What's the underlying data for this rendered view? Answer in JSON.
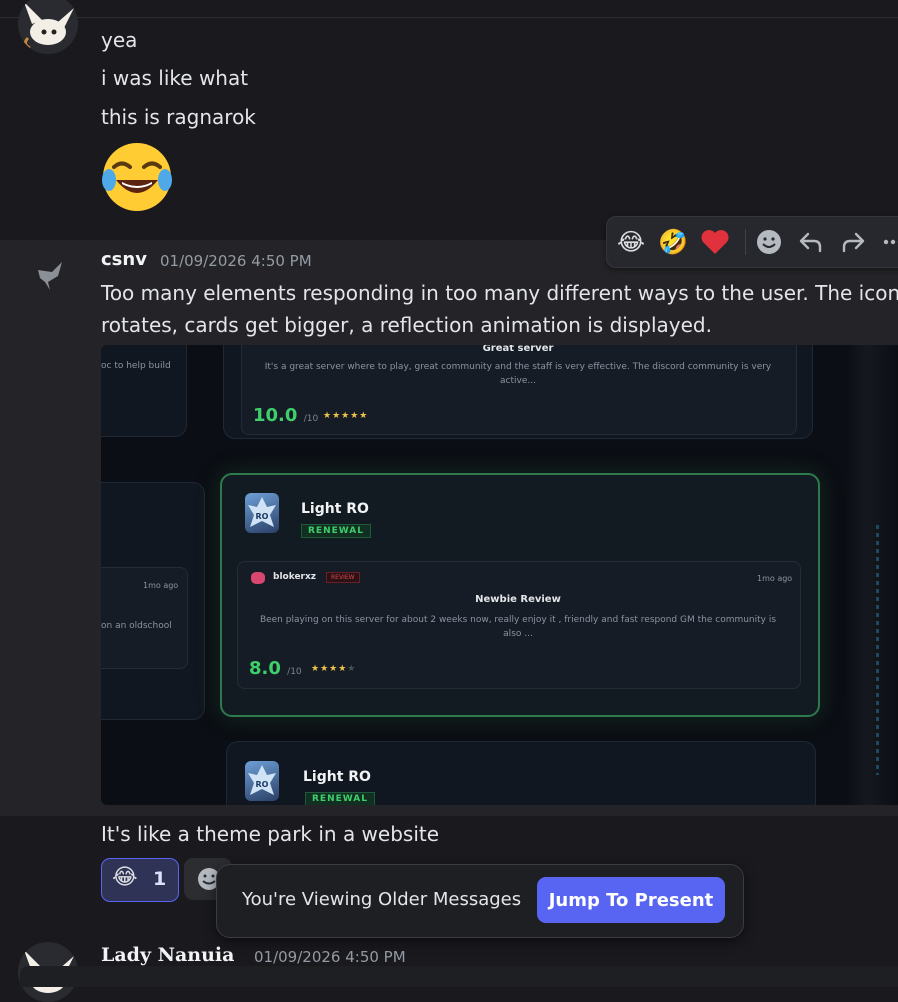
{
  "messages": {
    "first": {
      "lines": [
        "yea",
        "i was like what",
        "this is ragnarok"
      ],
      "big_emoji": "😂"
    },
    "csnv": {
      "username": "csnv",
      "timestamp": "01/09/2026 4:50 PM",
      "text_line1": "Too many elements responding in too many different ways to the user. The icon",
      "text_line2": "rotates, cards get bigger, a reflection animation is displayed.",
      "follow_up": "It's like a theme park in a website",
      "reaction": {
        "emoji": "😂",
        "count": "1"
      }
    },
    "lady": {
      "username": "Lady Nanuia",
      "timestamp": "01/09/2026 4:50 PM"
    }
  },
  "toolbar": {
    "reactions": [
      "😂",
      "🤣",
      "❤️"
    ],
    "icons": [
      "add-reaction-icon",
      "reply-icon",
      "forward-icon",
      "more-icon"
    ]
  },
  "embed": {
    "top_card": {
      "title": "Great server",
      "body_line1": "It's a great server where to play, great community and the staff is very effective. The discord community is very",
      "body_line2": "active...",
      "score": "10.0",
      "score_suffix": "/10",
      "stars": "★★★★★"
    },
    "left_snippet_top": "oc to help build",
    "left_time": "1mo ago",
    "left_snippet_mid": "on an oldschool",
    "featured_card": {
      "server_name": "Light RO",
      "badge": "RENEWAL",
      "reviewer": "blokerxz",
      "reviewer_badge": "REVIEW",
      "time": "1mo ago",
      "review_title": "Newbie Review",
      "review_line1": "Been playing on this server for about 2 weeks now, really enjoy it , friendly and fast respond GM the community is",
      "review_line2": "also ...",
      "score": "8.0",
      "score_suffix": "/10",
      "stars": "★★★★",
      "star_empty": "★"
    },
    "bottom_card": {
      "server_name": "Light RO",
      "badge": "RENEWAL"
    }
  },
  "notice": {
    "text": "You're Viewing Older Messages",
    "button": "Jump To Present"
  },
  "colors": {
    "background": "#1a1a1e",
    "accent": "#5865f2",
    "green": "#3ecf6a"
  }
}
